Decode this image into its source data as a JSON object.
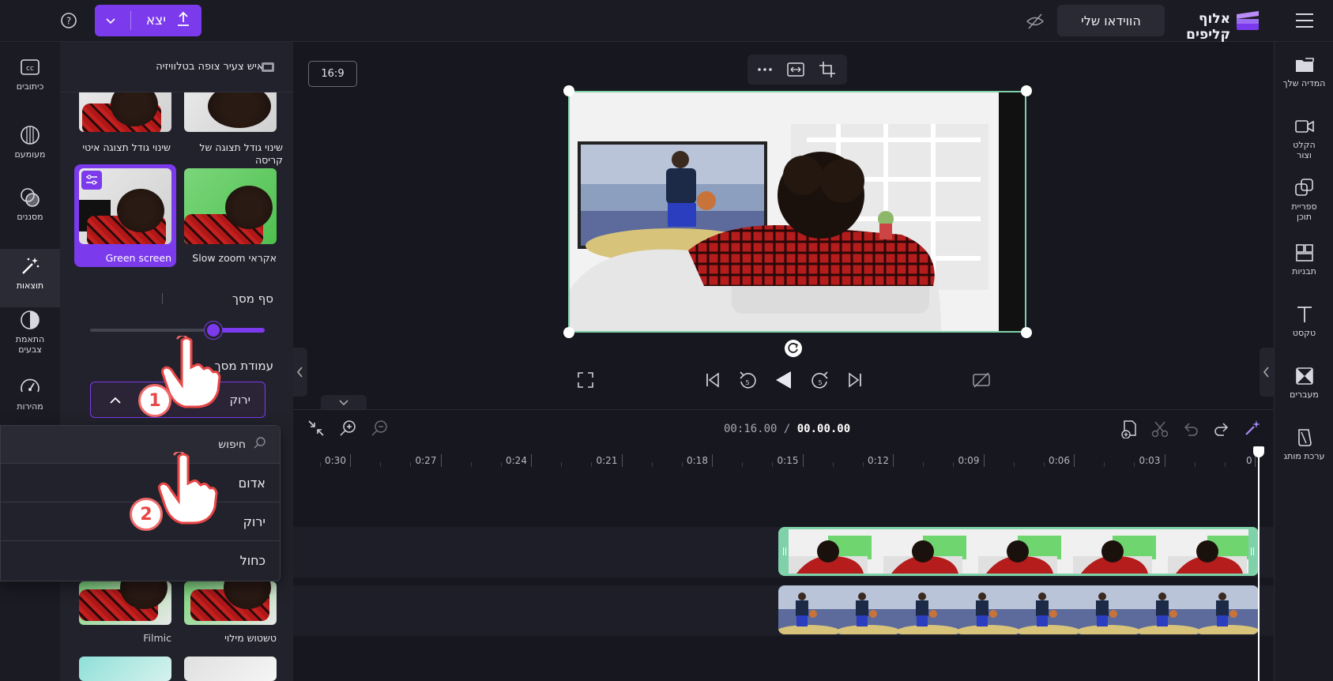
{
  "topbar": {
    "export_label": "יצא",
    "video_title": "הווידאו שלי",
    "brand_name": "אלוף קליפים"
  },
  "right_nav": {
    "items": [
      {
        "label": "המדיה שלך",
        "icon": "folder-icon"
      },
      {
        "label": "הקלט וצור",
        "icon": "record-icon"
      },
      {
        "label": "ספריית תוכן",
        "icon": "library-icon"
      },
      {
        "label": "תבניות",
        "icon": "templates-icon"
      },
      {
        "label": "טקסט",
        "icon": "text-icon"
      },
      {
        "label": "מעברים",
        "icon": "transitions-icon"
      },
      {
        "label": "ערכת מותג",
        "icon": "brand-kit-icon"
      }
    ]
  },
  "left_nav": {
    "items": [
      {
        "label": "כיתובים",
        "icon": "captions-icon"
      },
      {
        "label": "מעומעם",
        "icon": "fade-icon"
      },
      {
        "label": "מסננים",
        "icon": "filters-icon"
      },
      {
        "label": "תוצאות",
        "icon": "effects-icon"
      },
      {
        "label": "התאמת צבעים",
        "icon": "color-adjust-icon"
      },
      {
        "label": "מהירות",
        "icon": "speed-icon"
      }
    ]
  },
  "panel": {
    "clip_title": "איש צעיר צופה בטלוויזיה...",
    "effects": [
      {
        "label": "שינוי גודל תצוגה איטי"
      },
      {
        "label": "שינוי גודל תצוגה של קריסה"
      },
      {
        "label": "Green screen"
      },
      {
        "label": "Slow zoom אקראי"
      },
      {
        "label": "Filmic"
      },
      {
        "label": "טשטוש מילוי"
      }
    ],
    "threshold_label": "סף מסך",
    "threshold_value": 0.68,
    "screen_color_label": "עמודת מסך",
    "selected_color": "ירוק"
  },
  "dropdown": {
    "search_placeholder": "חיפוש",
    "options": [
      "אדום",
      "ירוק",
      "כחול"
    ]
  },
  "preview": {
    "aspect_ratio": "16:9"
  },
  "timeline": {
    "current_time": "00.00.00",
    "total_time": "00:16.00",
    "ticks": [
      "0",
      "0:03",
      "0:06",
      "0:09",
      "0:12",
      "0:15",
      "0:18",
      "0:21",
      "0:24",
      "0:27",
      "0:30"
    ]
  },
  "annotations": {
    "step1": "1",
    "step2": "2"
  },
  "colors": {
    "accent": "#7c3aed",
    "selection": "#7fd1a9",
    "pointer_badge": "#e84545"
  }
}
